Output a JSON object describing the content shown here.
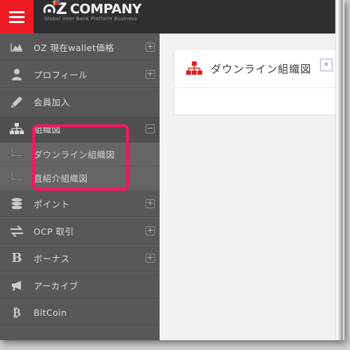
{
  "brand": {
    "o_letter": "O",
    "z_letter": "Z",
    "company": "COMPANY",
    "tagline": "Global Inter Bank Platform Business",
    "menu_icon": "hamburger-icon",
    "accent_color": "#ed1c24",
    "bar_color": "#2f2f33"
  },
  "sidebar": {
    "background": "#585858",
    "items": [
      {
        "label": "OZ 現在wallet価格",
        "icon": "chart-area-icon",
        "toggle": "plus",
        "active": false
      },
      {
        "label": "プロフィール",
        "icon": "user-icon",
        "toggle": "plus",
        "active": false
      },
      {
        "label": "会員加入",
        "icon": "pencil-icon",
        "toggle": "none",
        "active": false
      },
      {
        "label": "組織図",
        "icon": "sitemap-icon",
        "toggle": "minus",
        "active": true
      },
      {
        "label": "ポイント",
        "icon": "database-icon",
        "toggle": "plus",
        "active": false
      },
      {
        "label": "OCP 取引",
        "icon": "exchange-icon",
        "toggle": "plus",
        "active": false
      },
      {
        "label": "ボーナス",
        "icon": "bold-b-icon",
        "toggle": "plus",
        "active": false
      },
      {
        "label": "アーカイブ",
        "icon": "bullhorn-icon",
        "toggle": "none",
        "active": false
      },
      {
        "label": "BitCoin",
        "icon": "bitcoin-icon",
        "toggle": "none",
        "active": false
      }
    ],
    "submenu": [
      {
        "label": "ダウンライン組織図"
      },
      {
        "label": "直紹介組織図"
      }
    ]
  },
  "annotation": {
    "name": "highlight-rectangle",
    "color": "#f3175e"
  },
  "content": {
    "card_title": "ダウンライン組織図",
    "card_icon": "sitemap-icon",
    "card_icon_color": "#dd2222",
    "broken_image_glyph": "✕"
  }
}
